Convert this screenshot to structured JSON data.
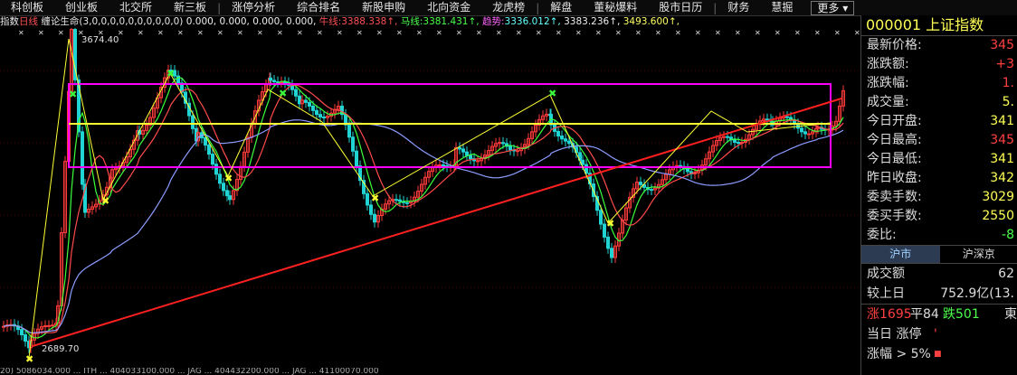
{
  "tabs": [
    "科创板",
    "创业板",
    "北交所",
    "新三板",
    "涨停分析",
    "综合排名",
    "新股申购",
    "北向资金",
    "龙虎榜",
    "解盘",
    "董秘爆料",
    "股市日历",
    "财务",
    "慧掘"
  ],
  "more_label": "更多",
  "indicator": {
    "prefix": "指数",
    "period": "日线",
    "name": "缠论生命(3,0,0,0,0,0,0,0,0,0,0)",
    "values": "0.000, 0.000, 0.000, 0.000,",
    "bull_label": "牛线:",
    "bull_value": "3388.338↑,",
    "horse_label": "马线:",
    "horse_value": "3381.431↑,",
    "trend_label": "趋势:",
    "trend_value": "3336.012↑,",
    "v4": "3383.236↑,",
    "v5": "3493.600↑,"
  },
  "chart_labels": {
    "high": "3674.40",
    "low": "2689.70"
  },
  "bottom_status": "20) 5086034.000 ... ITH ... 404033100.000 ... JAG ... 404432200.000 ... JAG ... 41100070.000",
  "panel": {
    "code": "000001",
    "name": "上证指数",
    "rows1": [
      {
        "label": "最新价格:",
        "value": "345",
        "cls": ""
      },
      {
        "label": "涨跌额:",
        "value": "+3",
        "cls": ""
      },
      {
        "label": "涨跌幅:",
        "value": "1.",
        "cls": ""
      },
      {
        "label": "成交量:",
        "value": "5.",
        "cls": "y"
      },
      {
        "label": "今日开盘:",
        "value": "341",
        "cls": "y"
      },
      {
        "label": "今日最高:",
        "value": "345",
        "cls": ""
      },
      {
        "label": "今日最低:",
        "value": "341",
        "cls": "y"
      },
      {
        "label": "昨日收盘:",
        "value": "342",
        "cls": "y"
      },
      {
        "label": "委卖手数:",
        "value": "3029",
        "cls": "y"
      },
      {
        "label": "委买手数:",
        "value": "2550",
        "cls": "y"
      },
      {
        "label": "委比:",
        "value": "-8",
        "cls": "g"
      }
    ],
    "market_tabs": [
      "沪市",
      "沪深京"
    ],
    "turnover_label": "成交额",
    "turnover_value": "62",
    "compare_label": "较上日",
    "compare_value": "752.9亿(13.",
    "up_label": "涨1695",
    "flat_label": "平84",
    "down_label": "跌501",
    "extra_label": "東",
    "today_label": "当日 涨停",
    "today_mark": "'",
    "rise_label": "涨幅 > 5%",
    "rise_mark": "■"
  },
  "colors": {
    "up": "#ff3b3b",
    "down": "#21d4d4",
    "box": "#ff00ff",
    "trend": "#ff2020",
    "ma_blue": "#8c9cff",
    "ma_red": "#ff4a4a",
    "ma_green": "#3cff3c",
    "yellow": "#ffff33"
  }
}
